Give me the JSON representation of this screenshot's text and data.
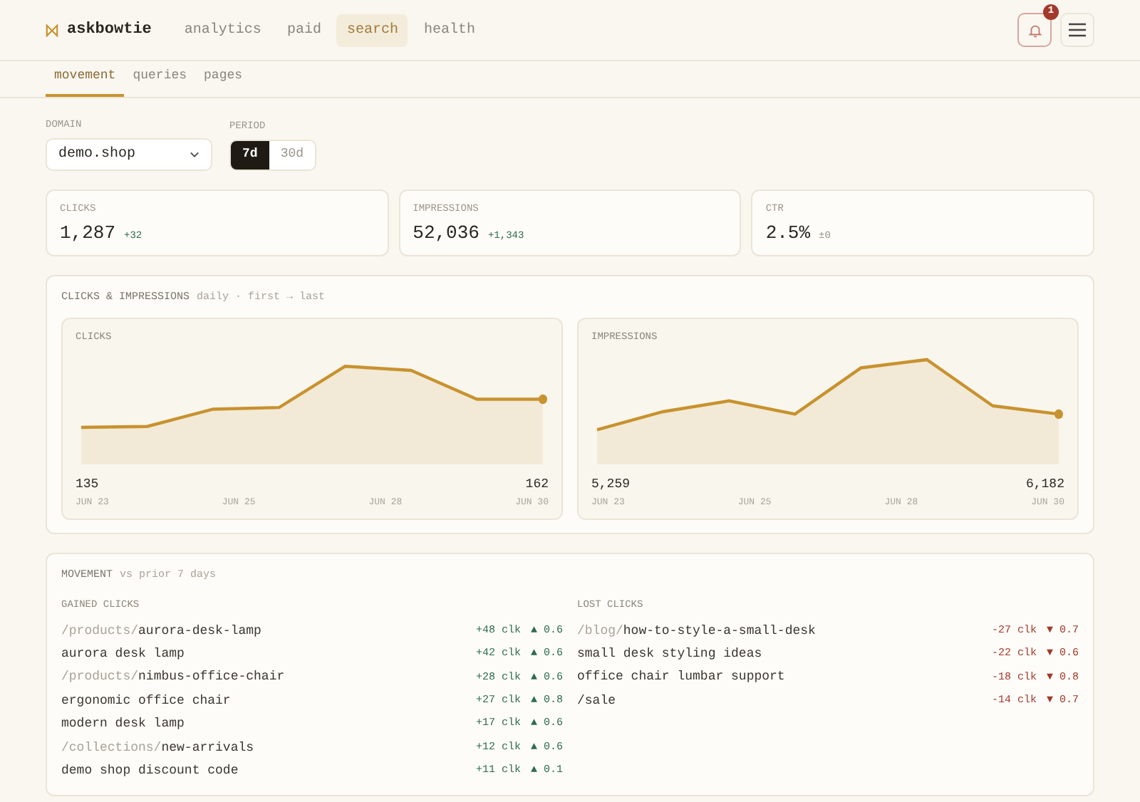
{
  "brand": {
    "name": "askbowtie"
  },
  "nav": [
    {
      "label": "analytics",
      "selected": false
    },
    {
      "label": "paid",
      "selected": false
    },
    {
      "label": "search",
      "selected": true
    },
    {
      "label": "health",
      "selected": false
    }
  ],
  "notifications": {
    "count": "1"
  },
  "subtabs": [
    {
      "label": "movement",
      "selected": true
    },
    {
      "label": "queries",
      "selected": false
    },
    {
      "label": "pages",
      "selected": false
    }
  ],
  "domain": {
    "label": "DOMAIN",
    "value": "demo.shop"
  },
  "period": {
    "label": "PERIOD",
    "options": [
      {
        "label": "7d",
        "selected": true
      },
      {
        "label": "30d",
        "selected": false
      }
    ]
  },
  "stats": [
    {
      "label": "CLICKS",
      "value": "1,287",
      "delta": "+32",
      "color": "#2f6b4f"
    },
    {
      "label": "IMPRESSIONS",
      "value": "52,036",
      "delta": "+1,343",
      "color": "#2f6b4f"
    },
    {
      "label": "CTR",
      "value": "2.5%",
      "delta": "±0",
      "color": "#9a958b"
    }
  ],
  "trends": {
    "title": "CLICKS & IMPRESSIONS",
    "subtitle": "daily · first → last",
    "charts": [
      {
        "label": "CLICKS",
        "first": "135",
        "last": "162",
        "dates": [
          "JUN 23",
          "JUN 25",
          "JUN 28",
          "JUN 30"
        ]
      },
      {
        "label": "IMPRESSIONS",
        "first": "5,259",
        "last": "6,182",
        "dates": [
          "JUN 23",
          "JUN 25",
          "JUN 28",
          "JUN 30"
        ]
      }
    ]
  },
  "movement": {
    "title": "MOVEMENT",
    "subtitle": "vs prior 7 days",
    "columns": [
      {
        "heading": "GAINED CLICKS",
        "color": "#2f6b4f",
        "rows": [
          {
            "prefix": "/products/",
            "label": "aurora-desk-lamp",
            "clicks": "+48 clk",
            "change": "▲ 0.6"
          },
          {
            "label": "aurora desk lamp",
            "clicks": "+42 clk",
            "change": "▲ 0.6"
          },
          {
            "prefix": "/products/",
            "label": "nimbus-office-chair",
            "clicks": "+28 clk",
            "change": "▲ 0.6"
          },
          {
            "label": "ergonomic office chair",
            "clicks": "+27 clk",
            "change": "▲ 0.8"
          },
          {
            "label": "modern desk lamp",
            "clicks": "+17 clk",
            "change": "▲ 0.6"
          },
          {
            "prefix": "/collections/",
            "label": "new-arrivals",
            "clicks": "+12 clk",
            "change": "▲ 0.6"
          },
          {
            "label": "demo shop discount code",
            "clicks": "+11 clk",
            "change": "▲ 0.1"
          }
        ]
      },
      {
        "heading": "LOST CLICKS",
        "color": "#a3392b",
        "rows": [
          {
            "prefix": "/blog/",
            "label": "how-to-style-a-small-desk",
            "clicks": "-27 clk",
            "change": "▼ 0.7"
          },
          {
            "label": "small desk styling ideas",
            "clicks": "-22 clk",
            "change": "▼ 0.6"
          },
          {
            "label": "office chair lumbar support",
            "clicks": "-18 clk",
            "change": "▼ 0.8"
          },
          {
            "label": "/sale",
            "clicks": "-14 clk",
            "change": "▼ 0.7"
          }
        ]
      }
    ]
  }
}
